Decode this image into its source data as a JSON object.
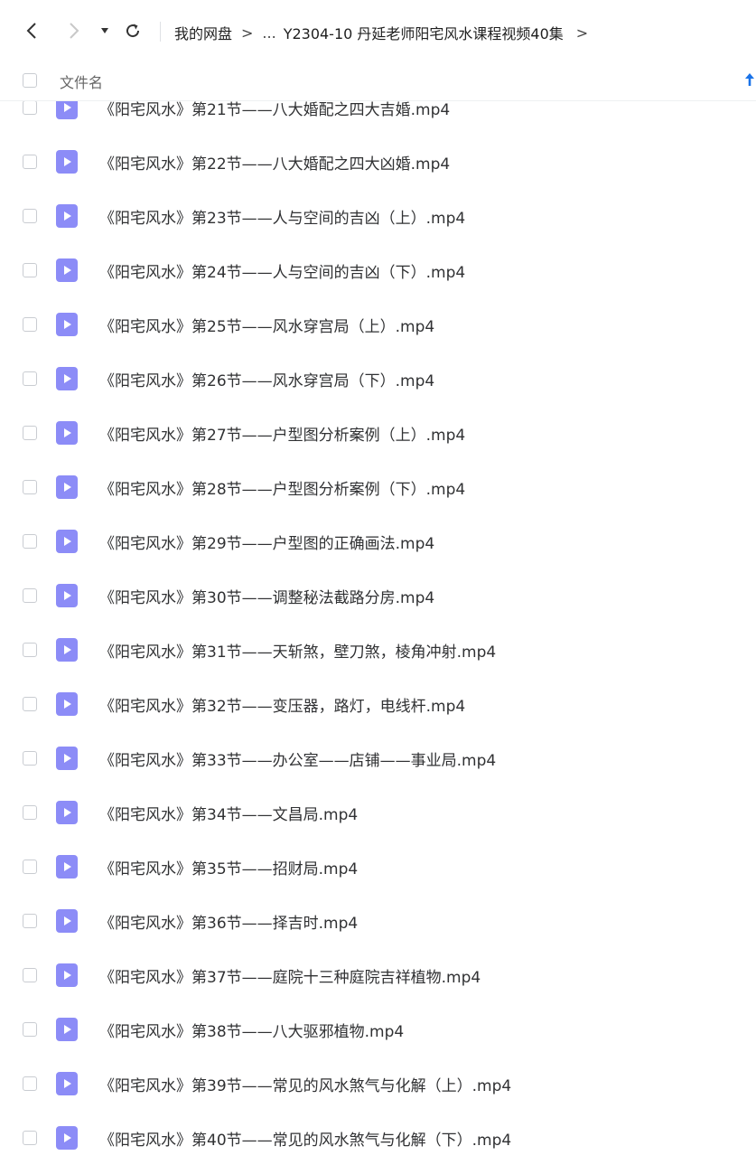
{
  "breadcrumb": {
    "root": "我的网盘",
    "ellipsis": "...",
    "current": "Y2304-10 丹延老师阳宅风水课程视频40集"
  },
  "header": {
    "column_name": "文件名"
  },
  "colors": {
    "accent": "#1a73e8",
    "file_icon": "#8c8cf7"
  },
  "files": [
    "《阳宅风水》第21节——八大婚配之四大吉婚.mp4",
    "《阳宅风水》第22节——八大婚配之四大凶婚.mp4",
    "《阳宅风水》第23节——人与空间的吉凶（上）.mp4",
    "《阳宅风水》第24节——人与空间的吉凶（下）.mp4",
    "《阳宅风水》第25节——风水穿宫局（上）.mp4",
    "《阳宅风水》第26节——风水穿宫局（下）.mp4",
    "《阳宅风水》第27节——户型图分析案例（上）.mp4",
    "《阳宅风水》第28节——户型图分析案例（下）.mp4",
    "《阳宅风水》第29节——户型图的正确画法.mp4",
    "《阳宅风水》第30节——调整秘法截路分房.mp4",
    "《阳宅风水》第31节——天斩煞，壁刀煞，棱角冲射.mp4",
    "《阳宅风水》第32节——变压器，路灯，电线杆.mp4",
    "《阳宅风水》第33节——办公室——店铺——事业局.mp4",
    "《阳宅风水》第34节——文昌局.mp4",
    "《阳宅风水》第35节——招财局.mp4",
    "《阳宅风水》第36节——择吉时.mp4",
    "《阳宅风水》第37节——庭院十三种庭院吉祥植物.mp4",
    "《阳宅风水》第38节——八大驱邪植物.mp4",
    "《阳宅风水》第39节——常见的风水煞气与化解（上）.mp4",
    "《阳宅风水》第40节——常见的风水煞气与化解（下）.mp4"
  ]
}
